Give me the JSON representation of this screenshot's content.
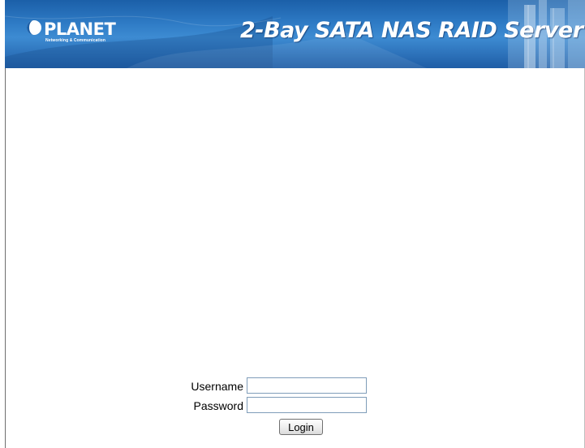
{
  "header": {
    "logo_text": "PLANET",
    "logo_subtext": "Networking & Communication",
    "product_title": "2-Bay SATA NAS RAID Server"
  },
  "login": {
    "username_label": "Username",
    "username_value": "",
    "password_label": "Password",
    "password_value": "",
    "button_label": "Login"
  },
  "colors": {
    "banner": "#2f7cc6",
    "banner_dark": "#1b5fa8",
    "text": "#000000",
    "input_border": "#7f9db9"
  },
  "icons": {
    "logo": "planet-logo-icon"
  }
}
